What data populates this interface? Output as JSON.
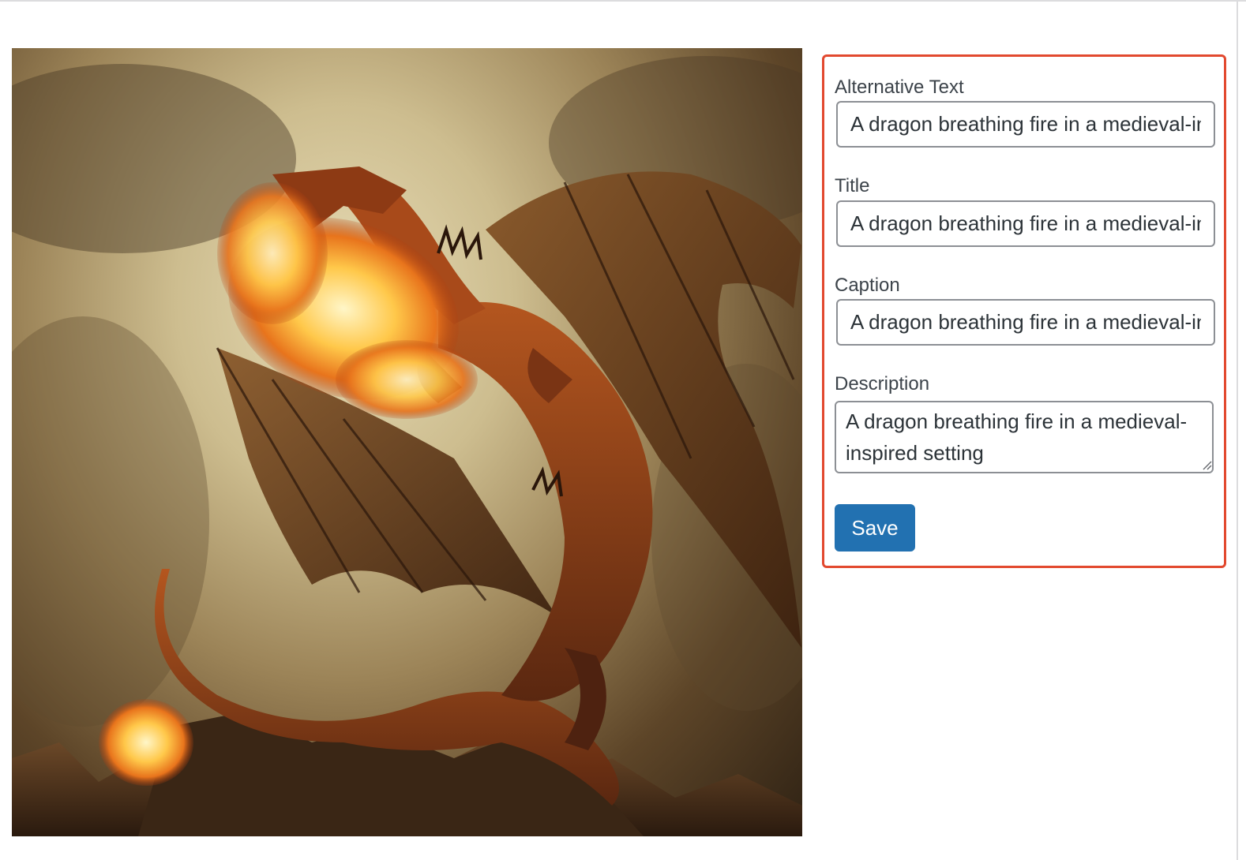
{
  "preview": {
    "alt": "A dragon breathing fire in a medieval-inspired setting"
  },
  "fields": {
    "alt_text": {
      "label": "Alternative Text",
      "value": "A dragon breathing fire in a medieval-inspired setting"
    },
    "title": {
      "label": "Title",
      "value": "A dragon breathing fire in a medieval-inspired setting"
    },
    "caption": {
      "label": "Caption",
      "value": "A dragon breathing fire in a medieval-inspired setting"
    },
    "description": {
      "label": "Description",
      "value": "A dragon breathing fire in a medieval-inspired setting"
    }
  },
  "actions": {
    "save_label": "Save"
  },
  "colors": {
    "highlight_border": "#e2492f",
    "primary_button": "#2271b1",
    "input_border": "#8c8f94",
    "label_text": "#3c434a"
  }
}
